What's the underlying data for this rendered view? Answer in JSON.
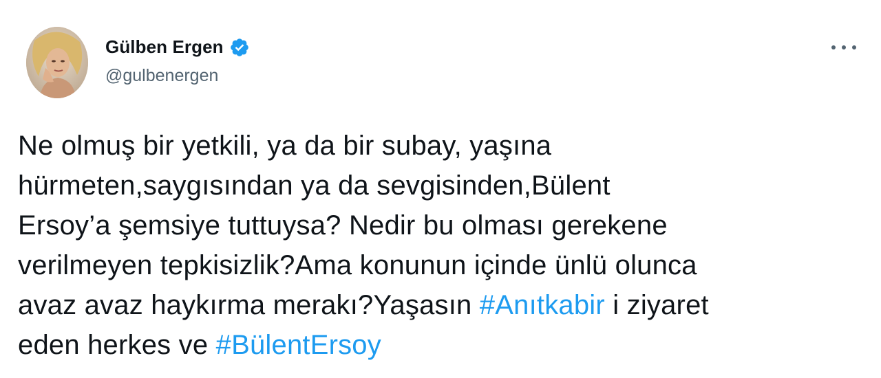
{
  "author": {
    "display_name": "Gülben Ergen",
    "handle": "@gulbenergen",
    "verified_icon": "verified-badge-icon",
    "avatar_icon": "profile-avatar"
  },
  "menu": {
    "icon": "more-options-icon"
  },
  "tweet": {
    "lines": [
      {
        "text": "Ne olmuş bir yetkili, ya da bir subay, yaşına"
      },
      {
        "text": "hürmeten,saygısından ya da sevgisinden,Bülent"
      },
      {
        "text": "Ersoy’a şemsiye tuttuysa? Nedir bu olması gerekene"
      },
      {
        "text": "verilmeyen tepkisizlik?Ama konunun içinde ünlü olunca"
      },
      {
        "pre": "avaz avaz haykırma merakı?Yaşasın ",
        "hashtag": "#Anıtkabir",
        "post": " i ziyaret"
      },
      {
        "pre": "eden herkes ve ",
        "hashtag": "#BülentErsoy",
        "post": ""
      }
    ]
  },
  "colors": {
    "text": "#0f1419",
    "secondary": "#536471",
    "link": "#1d9bf0",
    "verified": "#1d9bf0"
  }
}
